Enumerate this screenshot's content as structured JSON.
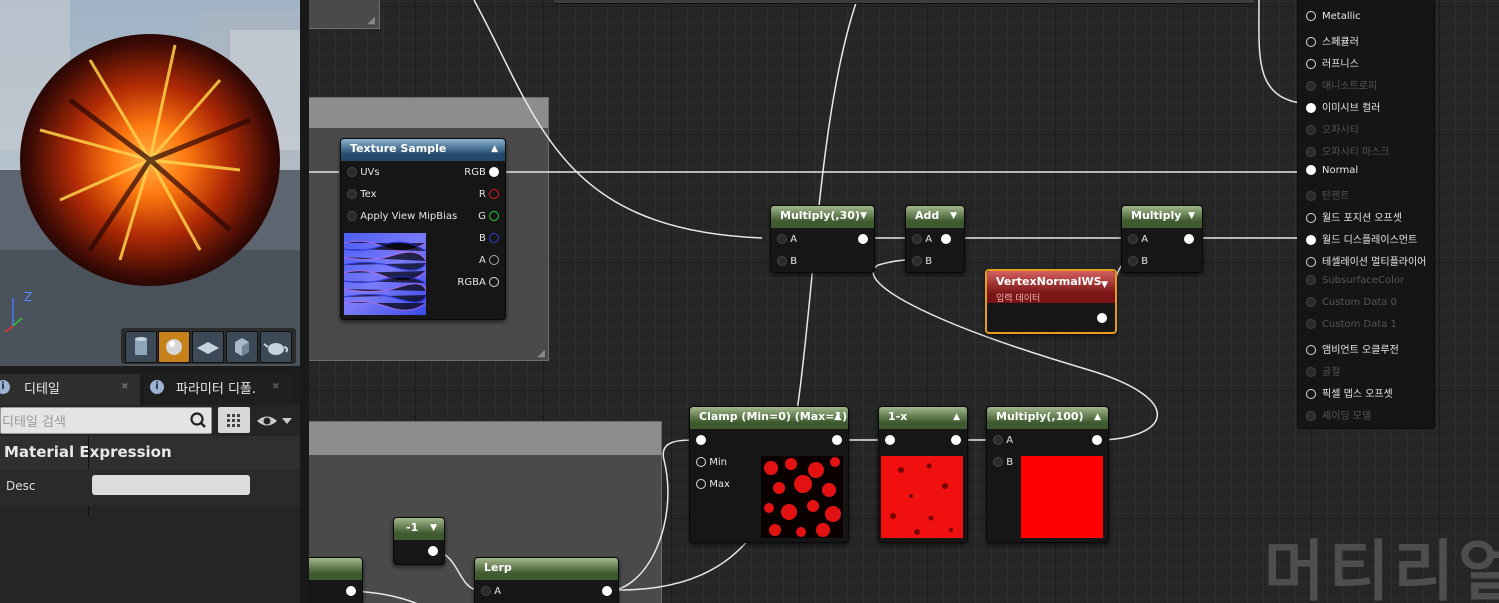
{
  "viewport": {
    "axis_z": "Z",
    "buttons": [
      "cylinder-icon",
      "sphere-icon",
      "plane-icon",
      "cube-icon",
      "teapot-icon"
    ]
  },
  "details_panel": {
    "tab_details": "디테일",
    "tab_params": "파라미터 디폴.",
    "search_placeholder": "디테일 검색",
    "section": "Material Expression",
    "desc_label": "Desc",
    "desc_value": ""
  },
  "nodes": {
    "texture_sample": {
      "title": "Texture Sample",
      "in_uvs": "UVs",
      "in_tex": "Tex",
      "in_mip": "Apply View MipBias",
      "out_rgb": "RGB",
      "out_r": "R",
      "out_g": "G",
      "out_b": "B",
      "out_a": "A",
      "out_rgba": "RGBA"
    },
    "multiply30": {
      "title": "Multiply(,30)",
      "a": "A",
      "b": "B"
    },
    "add": {
      "title": "Add",
      "a": "A",
      "b": "B"
    },
    "multiply": {
      "title": "Multiply",
      "a": "A",
      "b": "B"
    },
    "vertexnormal": {
      "title": "VertexNormalWS",
      "subtitle": "입력 데이터"
    },
    "clamp": {
      "title": "Clamp (Min=0) (Max=1)",
      "min": "Min",
      "max": "Max"
    },
    "oneminus": {
      "title": "1-x"
    },
    "multiply100": {
      "title": "Multiply(,100)",
      "a": "A",
      "b": "B"
    },
    "neg1": {
      "title": "-1"
    },
    "lerp": {
      "title": "Lerp",
      "a": "A"
    }
  },
  "material_output": {
    "pins": [
      {
        "label": "Metallic",
        "on": true
      },
      {
        "label": "스페큘러",
        "on": true
      },
      {
        "label": "러프니스",
        "on": true
      },
      {
        "label": "애니소트로피",
        "on": false
      },
      {
        "label": "이미시브 컬러",
        "on": true
      },
      {
        "label": "오파시티",
        "on": false
      },
      {
        "label": "오파시티 마스크",
        "on": false
      },
      {
        "label": "Normal",
        "on": true
      },
      {
        "label": "탄젠트",
        "on": false
      },
      {
        "label": "월드 포지션 오프셋",
        "on": true
      },
      {
        "label": "월드 디스플레이스먼트",
        "on": true
      },
      {
        "label": "테셀레이션 멀티플라이어",
        "on": true
      },
      {
        "label": "SubsurfaceColor",
        "on": false
      },
      {
        "label": "Custom Data 0",
        "on": false
      },
      {
        "label": "Custom Data 1",
        "on": false
      },
      {
        "label": "앰비언트 오클루전",
        "on": true
      },
      {
        "label": "굴절",
        "on": false
      },
      {
        "label": "픽셀 뎁스 오프셋",
        "on": true
      },
      {
        "label": "셰이딩 모델",
        "on": false
      }
    ]
  },
  "watermark": "머티리얼"
}
